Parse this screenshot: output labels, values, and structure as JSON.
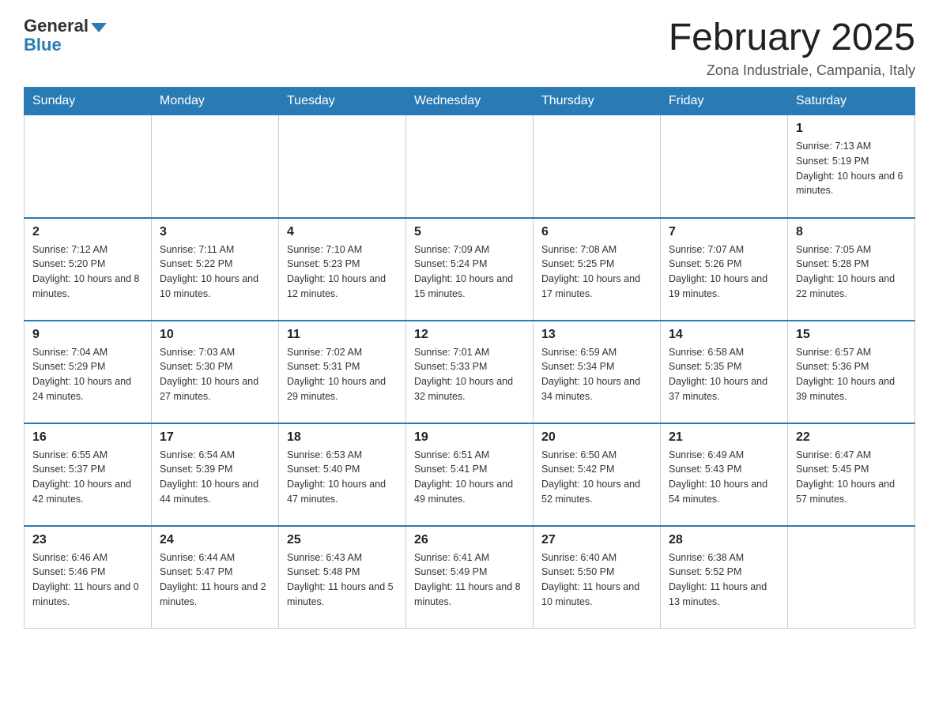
{
  "header": {
    "logo_general": "General",
    "logo_blue": "Blue",
    "month_title": "February 2025",
    "location": "Zona Industriale, Campania, Italy"
  },
  "days_of_week": [
    "Sunday",
    "Monday",
    "Tuesday",
    "Wednesday",
    "Thursday",
    "Friday",
    "Saturday"
  ],
  "weeks": [
    {
      "days": [
        {
          "number": "",
          "info": ""
        },
        {
          "number": "",
          "info": ""
        },
        {
          "number": "",
          "info": ""
        },
        {
          "number": "",
          "info": ""
        },
        {
          "number": "",
          "info": ""
        },
        {
          "number": "",
          "info": ""
        },
        {
          "number": "1",
          "info": "Sunrise: 7:13 AM\nSunset: 5:19 PM\nDaylight: 10 hours and 6 minutes."
        }
      ]
    },
    {
      "days": [
        {
          "number": "2",
          "info": "Sunrise: 7:12 AM\nSunset: 5:20 PM\nDaylight: 10 hours and 8 minutes."
        },
        {
          "number": "3",
          "info": "Sunrise: 7:11 AM\nSunset: 5:22 PM\nDaylight: 10 hours and 10 minutes."
        },
        {
          "number": "4",
          "info": "Sunrise: 7:10 AM\nSunset: 5:23 PM\nDaylight: 10 hours and 12 minutes."
        },
        {
          "number": "5",
          "info": "Sunrise: 7:09 AM\nSunset: 5:24 PM\nDaylight: 10 hours and 15 minutes."
        },
        {
          "number": "6",
          "info": "Sunrise: 7:08 AM\nSunset: 5:25 PM\nDaylight: 10 hours and 17 minutes."
        },
        {
          "number": "7",
          "info": "Sunrise: 7:07 AM\nSunset: 5:26 PM\nDaylight: 10 hours and 19 minutes."
        },
        {
          "number": "8",
          "info": "Sunrise: 7:05 AM\nSunset: 5:28 PM\nDaylight: 10 hours and 22 minutes."
        }
      ]
    },
    {
      "days": [
        {
          "number": "9",
          "info": "Sunrise: 7:04 AM\nSunset: 5:29 PM\nDaylight: 10 hours and 24 minutes."
        },
        {
          "number": "10",
          "info": "Sunrise: 7:03 AM\nSunset: 5:30 PM\nDaylight: 10 hours and 27 minutes."
        },
        {
          "number": "11",
          "info": "Sunrise: 7:02 AM\nSunset: 5:31 PM\nDaylight: 10 hours and 29 minutes."
        },
        {
          "number": "12",
          "info": "Sunrise: 7:01 AM\nSunset: 5:33 PM\nDaylight: 10 hours and 32 minutes."
        },
        {
          "number": "13",
          "info": "Sunrise: 6:59 AM\nSunset: 5:34 PM\nDaylight: 10 hours and 34 minutes."
        },
        {
          "number": "14",
          "info": "Sunrise: 6:58 AM\nSunset: 5:35 PM\nDaylight: 10 hours and 37 minutes."
        },
        {
          "number": "15",
          "info": "Sunrise: 6:57 AM\nSunset: 5:36 PM\nDaylight: 10 hours and 39 minutes."
        }
      ]
    },
    {
      "days": [
        {
          "number": "16",
          "info": "Sunrise: 6:55 AM\nSunset: 5:37 PM\nDaylight: 10 hours and 42 minutes."
        },
        {
          "number": "17",
          "info": "Sunrise: 6:54 AM\nSunset: 5:39 PM\nDaylight: 10 hours and 44 minutes."
        },
        {
          "number": "18",
          "info": "Sunrise: 6:53 AM\nSunset: 5:40 PM\nDaylight: 10 hours and 47 minutes."
        },
        {
          "number": "19",
          "info": "Sunrise: 6:51 AM\nSunset: 5:41 PM\nDaylight: 10 hours and 49 minutes."
        },
        {
          "number": "20",
          "info": "Sunrise: 6:50 AM\nSunset: 5:42 PM\nDaylight: 10 hours and 52 minutes."
        },
        {
          "number": "21",
          "info": "Sunrise: 6:49 AM\nSunset: 5:43 PM\nDaylight: 10 hours and 54 minutes."
        },
        {
          "number": "22",
          "info": "Sunrise: 6:47 AM\nSunset: 5:45 PM\nDaylight: 10 hours and 57 minutes."
        }
      ]
    },
    {
      "days": [
        {
          "number": "23",
          "info": "Sunrise: 6:46 AM\nSunset: 5:46 PM\nDaylight: 11 hours and 0 minutes."
        },
        {
          "number": "24",
          "info": "Sunrise: 6:44 AM\nSunset: 5:47 PM\nDaylight: 11 hours and 2 minutes."
        },
        {
          "number": "25",
          "info": "Sunrise: 6:43 AM\nSunset: 5:48 PM\nDaylight: 11 hours and 5 minutes."
        },
        {
          "number": "26",
          "info": "Sunrise: 6:41 AM\nSunset: 5:49 PM\nDaylight: 11 hours and 8 minutes."
        },
        {
          "number": "27",
          "info": "Sunrise: 6:40 AM\nSunset: 5:50 PM\nDaylight: 11 hours and 10 minutes."
        },
        {
          "number": "28",
          "info": "Sunrise: 6:38 AM\nSunset: 5:52 PM\nDaylight: 11 hours and 13 minutes."
        },
        {
          "number": "",
          "info": ""
        }
      ]
    }
  ]
}
